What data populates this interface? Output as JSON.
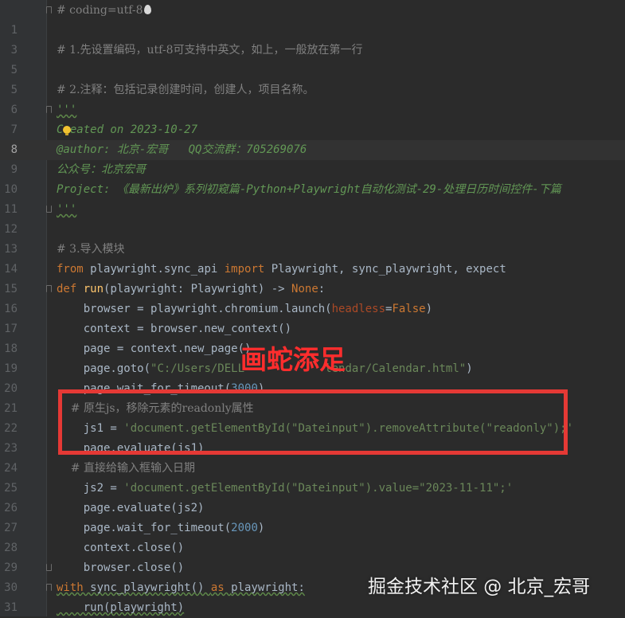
{
  "annotation_text": "画蛇添足",
  "watermark_text": "掘金技术社区 @ 北京_宏哥",
  "colors": {
    "background": "#2b2b2b",
    "highlight_box": "#e53935",
    "annotation": "#ff2d2d",
    "comment": "#808080",
    "docstring": "#629755",
    "keyword": "#cc7832",
    "string": "#6a8759"
  },
  "lines": [
    {
      "number": "",
      "tokens": [
        {
          "c": "comment",
          "t": "# coding=utf-8"
        }
      ]
    },
    {
      "number": "1",
      "tokens": []
    },
    {
      "number": "3",
      "tokens": [
        {
          "c": "comment",
          "t": "# 1.先设置编码，utf-8可支持中英文，如上，一般放在第一行"
        }
      ]
    },
    {
      "number": "5",
      "tokens": []
    },
    {
      "number": "5",
      "tokens": [
        {
          "c": "comment",
          "t": "# 2.注释：包括记录创建时间，创建人，项目名称。"
        }
      ]
    },
    {
      "number": "6",
      "tokens": [
        {
          "c": "doc",
          "t": "'''"
        }
      ]
    },
    {
      "number": "7",
      "tokens": [
        {
          "c": "doc",
          "t": "Created on 2023-10-27"
        }
      ]
    },
    {
      "number": "8",
      "tokens": [
        {
          "c": "doc",
          "t": "@author: 北京-宏哥   QQ交流群：705269076"
        }
      ]
    },
    {
      "number": "9",
      "tokens": [
        {
          "c": "doc",
          "t": "公众号：北京宏哥"
        }
      ]
    },
    {
      "number": "10",
      "tokens": [
        {
          "c": "doc",
          "t": "Project: 《最新出炉》系列初窥篇-Python+Playwright自动化测试-29-处理日历时间控件-下篇"
        }
      ]
    },
    {
      "number": "11",
      "tokens": [
        {
          "c": "doc",
          "t": "'''"
        }
      ]
    },
    {
      "number": "12",
      "tokens": []
    },
    {
      "number": "13",
      "tokens": [
        {
          "c": "comment",
          "t": "# 3.导入模块"
        }
      ]
    },
    {
      "number": "14",
      "tokens": [
        {
          "c": "kw",
          "t": "from "
        },
        {
          "c": "plain",
          "t": "playwright.sync_api "
        },
        {
          "c": "kw",
          "t": "import "
        },
        {
          "c": "plain",
          "t": "Playwright, sync_playwright, expect"
        }
      ]
    },
    {
      "number": "15",
      "tokens": [
        {
          "c": "kw",
          "t": "def "
        },
        {
          "c": "fn",
          "t": "run"
        },
        {
          "c": "plain",
          "t": "(playwright: Playwright) -> "
        },
        {
          "c": "kw",
          "t": "None"
        },
        {
          "c": "plain",
          "t": ":"
        }
      ]
    },
    {
      "number": "16",
      "tokens": [
        {
          "c": "plain",
          "t": "    browser = playwright.chromium.launch("
        },
        {
          "c": "param",
          "t": "headless"
        },
        {
          "c": "plain",
          "t": "="
        },
        {
          "c": "kw",
          "t": "False"
        },
        {
          "c": "plain",
          "t": ")"
        }
      ]
    },
    {
      "number": "17",
      "tokens": [
        {
          "c": "plain",
          "t": "    context = browser.new_context()"
        }
      ]
    },
    {
      "number": "18",
      "tokens": [
        {
          "c": "plain",
          "t": "    page = context.new_page()"
        }
      ]
    },
    {
      "number": "19",
      "tokens": [
        {
          "c": "plain",
          "t": "    page.goto("
        },
        {
          "c": "str",
          "t": "\"C:/Users/DELL"
        },
        {
          "c": "str",
          "t": "            lendar/Calendar.html\""
        },
        {
          "c": "plain",
          "t": ")"
        }
      ]
    },
    {
      "number": "20",
      "tokens": [
        {
          "c": "plain",
          "t": "    page.wait_for_timeout("
        },
        {
          "c": "num",
          "t": "3000"
        },
        {
          "c": "plain",
          "t": ")"
        }
      ]
    },
    {
      "number": "21",
      "tokens": [
        {
          "c": "comment",
          "t": "    # 原生js，移除元素的readonly属性"
        }
      ]
    },
    {
      "number": "22",
      "tokens": [
        {
          "c": "plain",
          "t": "    js1 = "
        },
        {
          "c": "str",
          "t": "'document.getElementById(\"Dateinput\").removeAttribute(\"readonly\");'"
        }
      ]
    },
    {
      "number": "23",
      "tokens": [
        {
          "c": "plain",
          "t": "    page.evaluate(js1)"
        }
      ]
    },
    {
      "number": "24",
      "tokens": [
        {
          "c": "comment",
          "t": "    # 直接给输入框输入日期"
        }
      ]
    },
    {
      "number": "25",
      "tokens": [
        {
          "c": "plain",
          "t": "    js2 = "
        },
        {
          "c": "str",
          "t": "'document.getElementById(\"Dateinput\").value=\"2023-11-11\";'"
        }
      ]
    },
    {
      "number": "26",
      "tokens": [
        {
          "c": "plain",
          "t": "    page.evaluate(js2)"
        }
      ]
    },
    {
      "number": "27",
      "tokens": [
        {
          "c": "plain",
          "t": "    page.wait_for_timeout("
        },
        {
          "c": "num",
          "t": "2000"
        },
        {
          "c": "plain",
          "t": ")"
        }
      ]
    },
    {
      "number": "28",
      "tokens": [
        {
          "c": "plain",
          "t": "    context.close()"
        }
      ]
    },
    {
      "number": "29",
      "tokens": [
        {
          "c": "plain",
          "t": "    browser.close()"
        }
      ]
    },
    {
      "number": "30",
      "tokens": [
        {
          "c": "kw",
          "t": "with "
        },
        {
          "c": "plain",
          "t": "sync_playwright() "
        },
        {
          "c": "kw",
          "t": "as "
        },
        {
          "c": "plain",
          "t": "playwright:"
        }
      ]
    },
    {
      "number": "31",
      "tokens": [
        {
          "c": "plain",
          "t": "    run(playwright)"
        }
      ]
    }
  ]
}
